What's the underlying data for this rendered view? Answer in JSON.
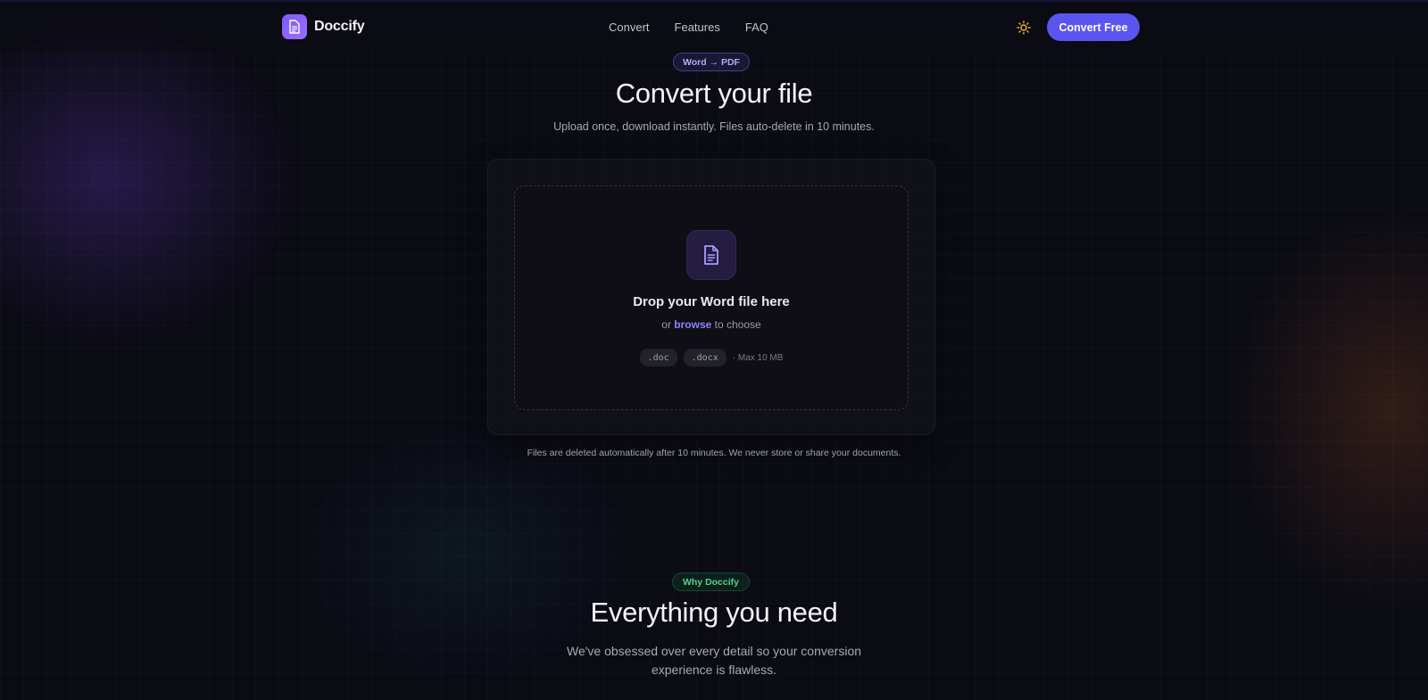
{
  "nav": {
    "brand": "Doccify",
    "links": [
      "Convert",
      "Features",
      "FAQ"
    ],
    "cta": "Convert Free",
    "theme_icon": "sun-icon"
  },
  "hero": {
    "badge": "Word → PDF",
    "title": "Convert your file",
    "subtitle": "Upload once, download instantly. Files auto-delete in 10 minutes."
  },
  "dropzone": {
    "icon": "document-icon",
    "title": "Drop your Word file here",
    "sub_prefix": "or",
    "browse": "browse",
    "sub_suffix": "to choose",
    "formats": [
      ".doc",
      ".docx"
    ],
    "limit": "· Max 10 MB"
  },
  "privacy_note": "Files are deleted automatically after 10 minutes. We never store or share your documents.",
  "features": {
    "badge": "Why Doccify",
    "title": "Everything you need",
    "subtitle": "We've obsessed over every detail so your conversion experience is flawless."
  },
  "colors": {
    "accent": "#5b55f0",
    "brand_gradient_start": "#7c5cf7",
    "link": "#8f86ff",
    "success": "#4fd28a",
    "background": "#0b0b14"
  }
}
